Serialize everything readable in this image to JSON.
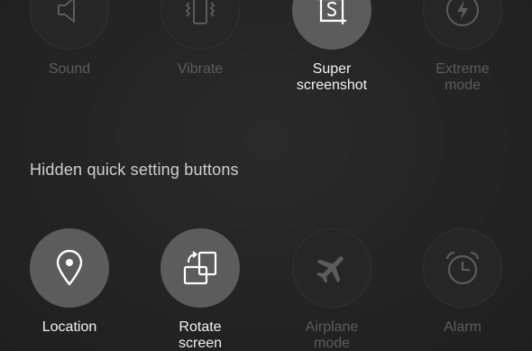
{
  "section_heading": "Hidden quick setting buttons",
  "colors": {
    "background": "#232323",
    "tile_active": "#5c5c5c",
    "tile_inactive": "#262626",
    "label_active": "#f2f2f2",
    "label_inactive": "#5c5c5c",
    "heading": "#cfcfcf"
  },
  "active_tiles": [
    {
      "label": "Sound",
      "icon": "speaker-icon",
      "highlighted": false
    },
    {
      "label": "Vibrate",
      "icon": "vibrate-icon",
      "highlighted": false
    },
    {
      "label": "Super\nscreenshot",
      "icon": "screenshot-icon",
      "highlighted": true
    },
    {
      "label": "Extreme\nmode",
      "icon": "power-saving-icon",
      "highlighted": false
    }
  ],
  "hidden_tiles": [
    {
      "label": "Location",
      "icon": "location-pin-icon",
      "highlighted": true
    },
    {
      "label": "Rotate\nscreen",
      "icon": "rotate-screen-icon",
      "highlighted": true
    },
    {
      "label": "Airplane\nmode",
      "icon": "airplane-icon",
      "highlighted": false
    },
    {
      "label": "Alarm",
      "icon": "alarm-clock-icon",
      "highlighted": false
    }
  ]
}
